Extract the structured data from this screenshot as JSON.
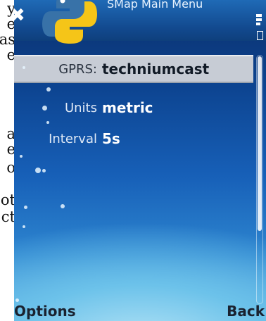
{
  "app": {
    "title": "SMap Main Menu"
  },
  "background_doc": {
    "lines": [
      "y",
      "e",
      "as",
      "e",
      "",
      "a",
      "e",
      "o",
      "ot",
      "ct"
    ]
  },
  "settings": {
    "rows": [
      {
        "label": "GPRS:",
        "value": "techniumcast",
        "selected": true
      },
      {
        "label": "Units",
        "value": "metric",
        "selected": false
      },
      {
        "label": "Interval",
        "value": "5s",
        "selected": false
      }
    ]
  },
  "softkeys": {
    "left": "Options",
    "right": "Back"
  },
  "icons": {
    "close": "close-icon",
    "logo": "python-logo-icon",
    "signal": "signal-strength-icon",
    "battery": "battery-icon"
  },
  "colors": {
    "screen_top": "#0a2f6c",
    "screen_bottom": "#5fb0e2",
    "selection": "#c7ccd5",
    "logo_blue": "#3872a8",
    "logo_yellow": "#f5c518"
  }
}
